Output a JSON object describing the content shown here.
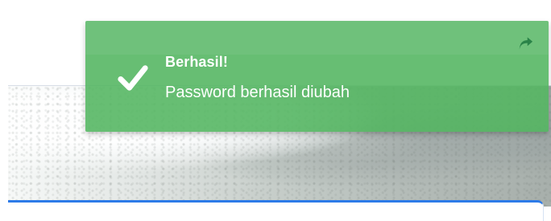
{
  "toast": {
    "title": "Berhasil!",
    "message": "Password berhasil diubah",
    "status_icon": "check-icon",
    "action_icon": "share-arrow-icon",
    "background_color": "#52b560",
    "text_color": "#ffffff"
  },
  "panel": {
    "accent_color": "#2d7be8"
  }
}
